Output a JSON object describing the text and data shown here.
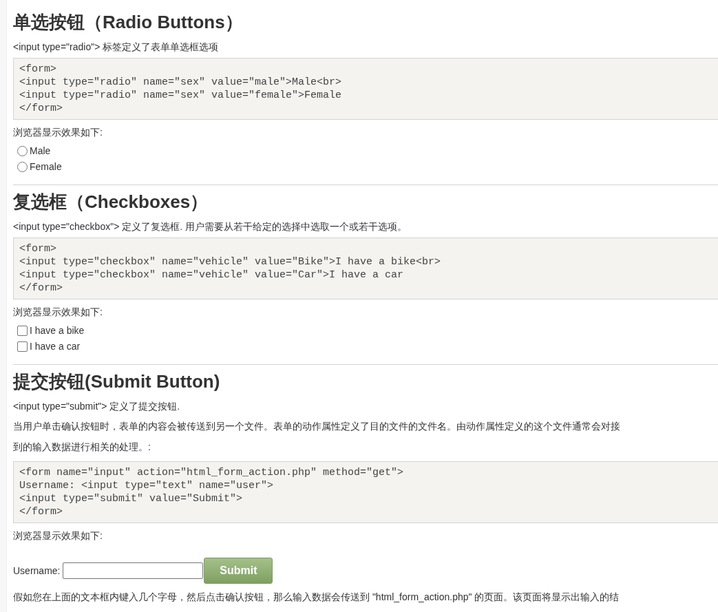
{
  "sections": [
    {
      "title": "单选按钮（Radio Buttons）",
      "intro": "<input type=\"radio\"> 标签定义了表单单选框选项",
      "code": [
        "<form>",
        "<input type=\"radio\" name=\"sex\" value=\"male\">Male<br>",
        "<input type=\"radio\" name=\"sex\" value=\"female\">Female",
        "</form>"
      ],
      "result_label": "浏览器显示效果如下:",
      "demo": {
        "kind": "radio",
        "options": [
          {
            "label": "Male",
            "checked": false
          },
          {
            "label": "Female",
            "checked": false
          }
        ]
      }
    },
    {
      "title": "复选框（Checkboxes）",
      "intro": "<input type=\"checkbox\"> 定义了复选框. 用户需要从若干给定的选择中选取一个或若干选项。",
      "code": [
        "<form>",
        "<input type=\"checkbox\" name=\"vehicle\" value=\"Bike\">I have a bike<br>",
        "<input type=\"checkbox\" name=\"vehicle\" value=\"Car\">I have a car",
        "</form>"
      ],
      "result_label": "浏览器显示效果如下:",
      "demo": {
        "kind": "checkbox",
        "options": [
          {
            "label": "I have a bike",
            "checked": false
          },
          {
            "label": "I have a car",
            "checked": false
          }
        ]
      }
    },
    {
      "title": "提交按钮(Submit Button)",
      "intro": "<input type=\"submit\"> 定义了提交按钮.",
      "paragraph_lines": [
        "当用户单击确认按钮时，表单的内容会被传送到另一个文件。表单的动作属性定义了目的文件的文件名。由动作属性定义的这个文件通常会对接",
        "到的输入数据进行相关的处理。:"
      ],
      "code": [
        "<form name=\"input\" action=\"html_form_action.php\" method=\"get\">",
        "Username: <input type=\"text\" name=\"user\">",
        "<input type=\"submit\" value=\"Submit\">",
        "</form>"
      ],
      "result_label": "浏览器显示效果如下:",
      "demo": {
        "kind": "submit",
        "field_label": "Username:",
        "button": "Submit"
      },
      "after": "假如您在上面的文本框内键入几个字母，然后点击确认按钮，那么输入数据会传送到 \"html_form_action.php\" 的页面。该页面将显示出输入的结"
    }
  ]
}
